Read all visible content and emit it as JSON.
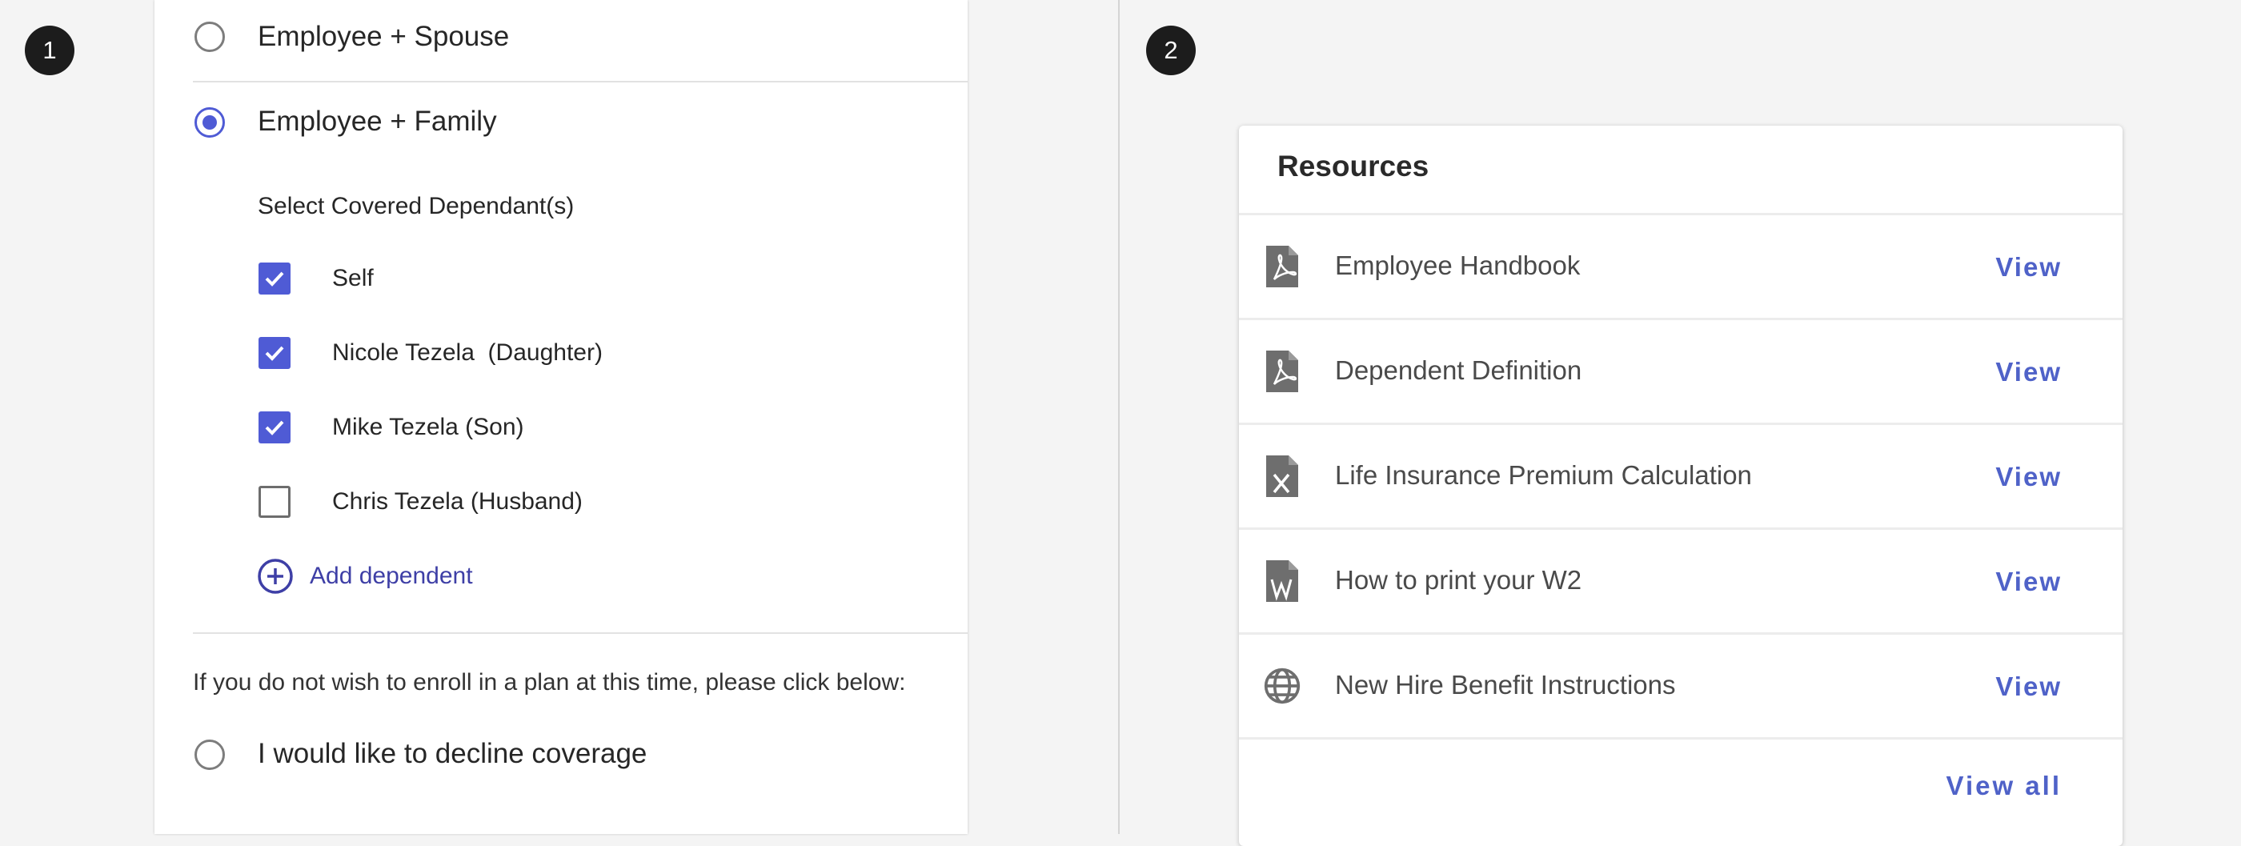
{
  "step_markers": [
    "1",
    "2"
  ],
  "coverage_panel": {
    "options": [
      {
        "label": "Employee + Spouse",
        "selected": false
      },
      {
        "label": "Employee + Family",
        "selected": true
      }
    ],
    "dependants_heading": "Select Covered Dependant(s)",
    "dependants": [
      {
        "label": "Self",
        "checked": true
      },
      {
        "label": "Nicole Tezela  (Daughter)",
        "checked": true
      },
      {
        "label": "Mike Tezela (Son)",
        "checked": true
      },
      {
        "label": "Chris Tezela (Husband)",
        "checked": false
      }
    ],
    "add_dependent_label": "Add dependent",
    "decline_note": "If you do not wish to enroll in a plan at this time, please click below:",
    "decline_option": {
      "label": "I would like to decline coverage",
      "selected": false
    },
    "accent_color": "#4f5bd5"
  },
  "resources_panel": {
    "title": "Resources",
    "items": [
      {
        "label": "Employee Handbook",
        "action": "View",
        "icon": "pdf-file-icon"
      },
      {
        "label": "Dependent Definition",
        "action": "View",
        "icon": "pdf-file-icon"
      },
      {
        "label": "Life Insurance Premium Calculation",
        "action": "View",
        "icon": "excel-file-icon"
      },
      {
        "label": "How to print your W2",
        "action": "View",
        "icon": "word-file-icon"
      },
      {
        "label": "New Hire Benefit Instructions",
        "action": "View",
        "icon": "globe-icon"
      }
    ],
    "view_all_label": "View all",
    "link_color": "#4f62c8"
  }
}
